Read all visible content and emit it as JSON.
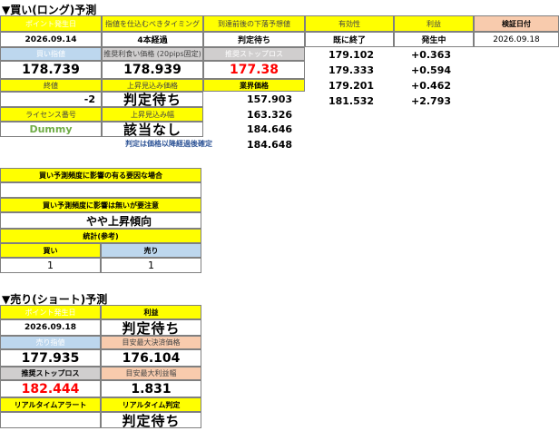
{
  "long": {
    "title": "▼買い(ロング)予測",
    "headers": {
      "point_date": "ポイント発生日",
      "timing": "指値を仕込むべきタイミング",
      "lower_target": "到達前後の下落予想値",
      "status": "有効性",
      "profit": "利益",
      "verify_date": "検証日付"
    },
    "values": {
      "point_date": "2026.09.14",
      "timing": "4本経過",
      "lower_target": "判定待ち",
      "status": "既に終了",
      "profit": "発生中",
      "verify_date": "2026.09.18"
    },
    "buy_limit_label": "買い指値",
    "recommend_label": "推奨利食い価格 (20pips固定)",
    "stop_label": "推奨ストップロス",
    "buy_limit": "178.739",
    "recommend": "178.939",
    "stop": "177.38",
    "close_label": "終値",
    "upper_label": "上昇見込み価格",
    "result_label": "業界価格",
    "close": "-2",
    "upper": "判定待ち",
    "license_label": "ライセンス番号",
    "upper_range_label": "上昇見込み幅",
    "license": "Dummy",
    "upper_range": "該当なし",
    "note": "判定は価格以降経過後確定",
    "price_column": [
      "157.903",
      "163.326",
      "184.646",
      "184.648"
    ],
    "result_column": [
      "179.102",
      "179.333",
      "179.201",
      "181.532"
    ],
    "diff_column": [
      "+0.363",
      "+0.594",
      "+0.462",
      "+2.793"
    ]
  },
  "middle": {
    "factor_label": "買い予測頻度に影響の有る要因な場合",
    "factor_value": "",
    "impact_label": "買い予測頻度に影響は無いが要注意",
    "impact_value": "やや上昇傾向",
    "stats_label": "統計(参考)",
    "buy_label": "買い",
    "sell_label": "売り",
    "buy_count": "1",
    "sell_count": "1"
  },
  "short": {
    "title": "▼売り(ショート)予測",
    "point_date_label": "ポイント発生日",
    "profit_label": "利益",
    "point_date": "2026.09.18",
    "profit": "判定待ち",
    "sell_limit_label": "売り指値",
    "target_label": "目安最大決済価格",
    "sell_limit": "177.935",
    "target": "176.104",
    "stop_label": "推奨ストップロス",
    "max_range_label": "目安最大利益幅",
    "stop": "182.444",
    "max_range": "1.831",
    "alert_label": "リアルタイムアラート",
    "realtime_label": "リアルタイム判定",
    "alert": "",
    "realtime": "判定待ち"
  }
}
